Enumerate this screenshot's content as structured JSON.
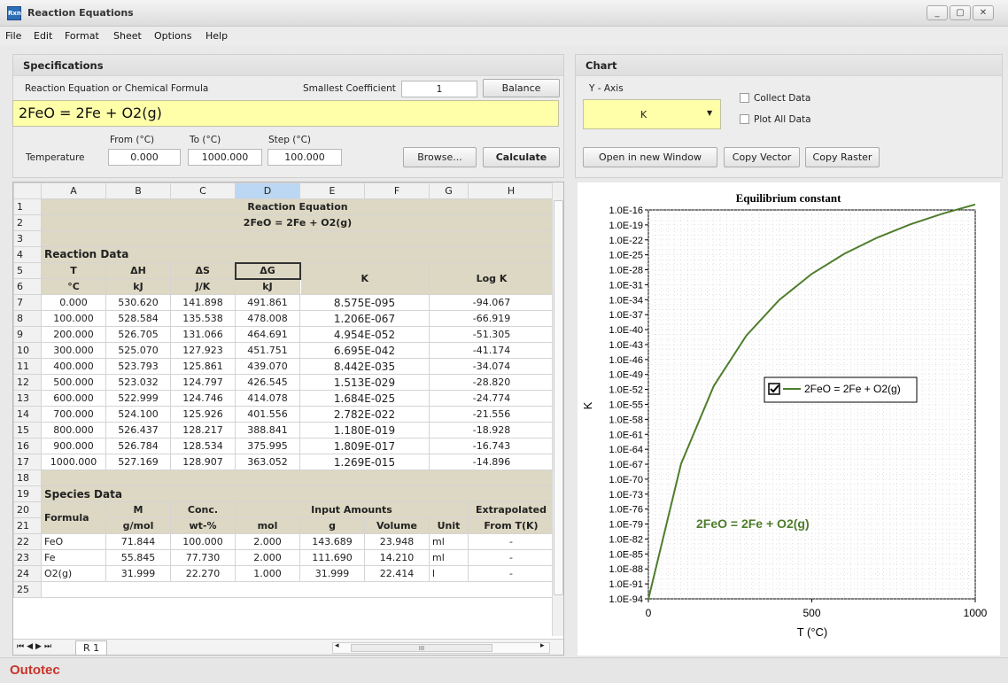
{
  "window": {
    "title": "Reaction Equations",
    "icon_text": "Rxn",
    "controls": [
      "_",
      "▢",
      "✕"
    ]
  },
  "menu": [
    "File",
    "Edit",
    "Format",
    "Sheet",
    "Options",
    "Help"
  ],
  "specs": {
    "heading": "Specifications",
    "eq_label": "Reaction Equation or Chemical Formula",
    "coef_label": "Smallest Coefficient",
    "coef_value": "1",
    "balance": "Balance",
    "equation": "2FeO = 2Fe + O2(g)",
    "from_label": "From (°C)",
    "to_label": "To (°C)",
    "step_label": "Step (°C)",
    "temp_label": "Temperature",
    "from_value": "0.000",
    "to_value": "1000.000",
    "step_value": "100.000",
    "browse": "Browse...",
    "calculate": "Calculate"
  },
  "chart_panel": {
    "heading": "Chart",
    "yaxis_label": "Y - Axis",
    "yaxis_value": "K",
    "collect": "Collect Data",
    "plot_all": "Plot All Data",
    "open_window": "Open in new Window",
    "copy_vector": "Copy Vector",
    "copy_raster": "Copy Raster"
  },
  "sheet": {
    "columns": [
      "A",
      "B",
      "C",
      "D",
      "E",
      "F",
      "G",
      "H"
    ],
    "title": "Reaction Equation",
    "equation": "2FeO = 2Fe + O2(g)",
    "reaction_data": "Reaction Data",
    "hdr1": [
      "T",
      "ΔH",
      "ΔS",
      "ΔG",
      "K",
      "Log K"
    ],
    "hdr2": [
      "°C",
      "kJ",
      "J/K",
      "kJ"
    ],
    "rows": [
      [
        "0.000",
        "530.620",
        "141.898",
        "491.861",
        "8.575E-095",
        "-94.067"
      ],
      [
        "100.000",
        "528.584",
        "135.538",
        "478.008",
        "1.206E-067",
        "-66.919"
      ],
      [
        "200.000",
        "526.705",
        "131.066",
        "464.691",
        "4.954E-052",
        "-51.305"
      ],
      [
        "300.000",
        "525.070",
        "127.923",
        "451.751",
        "6.695E-042",
        "-41.174"
      ],
      [
        "400.000",
        "523.793",
        "125.861",
        "439.070",
        "8.442E-035",
        "-34.074"
      ],
      [
        "500.000",
        "523.032",
        "124.797",
        "426.545",
        "1.513E-029",
        "-28.820"
      ],
      [
        "600.000",
        "522.999",
        "124.746",
        "414.078",
        "1.684E-025",
        "-24.774"
      ],
      [
        "700.000",
        "524.100",
        "125.926",
        "401.556",
        "2.782E-022",
        "-21.556"
      ],
      [
        "800.000",
        "526.437",
        "128.217",
        "388.841",
        "1.180E-019",
        "-18.928"
      ],
      [
        "900.000",
        "526.784",
        "128.534",
        "375.995",
        "1.809E-017",
        "-16.743"
      ],
      [
        "1000.000",
        "527.169",
        "128.907",
        "363.052",
        "1.269E-015",
        "-14.896"
      ]
    ],
    "species_data": "Species Data",
    "sp_hdr1": [
      "Formula",
      "M",
      "Conc.",
      "Input Amounts",
      "Extrapolated"
    ],
    "sp_hdr2": [
      "g/mol",
      "wt-%",
      "mol",
      "g",
      "Volume",
      "Unit",
      "From T(K)"
    ],
    "species": [
      [
        "FeO",
        "71.844",
        "100.000",
        "2.000",
        "143.689",
        "23.948",
        "ml",
        "-"
      ],
      [
        "Fe",
        "55.845",
        "77.730",
        "2.000",
        "111.690",
        "14.210",
        "ml",
        "-"
      ],
      [
        "O2(g)",
        "31.999",
        "22.270",
        "1.000",
        "31.999",
        "22.414",
        "l",
        "-"
      ]
    ],
    "tab": "R 1",
    "scroll_mid": "III"
  },
  "chart_data": {
    "type": "line",
    "title": "Equilibrium constant",
    "xlabel": "T (°C)",
    "ylabel": "K",
    "x": [
      0,
      100,
      200,
      300,
      400,
      500,
      600,
      700,
      800,
      900,
      1000
    ],
    "series": [
      {
        "name": "2FeO = 2Fe + O2(g)",
        "log10_values": [
          -94.067,
          -66.919,
          -51.305,
          -41.174,
          -34.074,
          -28.82,
          -24.774,
          -21.556,
          -18.928,
          -16.743,
          -14.896
        ]
      }
    ],
    "xlim": [
      0,
      1000
    ],
    "xticks": [
      "0",
      "500",
      "1000"
    ],
    "yticks": [
      "1.0E-16",
      "1.0E-19",
      "1.0E-22",
      "1.0E-25",
      "1.0E-28",
      "1.0E-31",
      "1.0E-34",
      "1.0E-37",
      "1.0E-40",
      "1.0E-43",
      "1.0E-46",
      "1.0E-49",
      "1.0E-52",
      "1.0E-55",
      "1.0E-58",
      "1.0E-61",
      "1.0E-64",
      "1.0E-67",
      "1.0E-70",
      "1.0E-73",
      "1.0E-76",
      "1.0E-79",
      "1.0E-82",
      "1.0E-85",
      "1.0E-88",
      "1.0E-91",
      "1.0E-94"
    ],
    "ylim_log10": [
      -94,
      -16
    ],
    "y_scale": "log",
    "grid": true,
    "legend": "right",
    "annotation": "2FeO = 2Fe + O2(g)",
    "line_color": "#4e7d2c"
  },
  "brand": "Outotec"
}
